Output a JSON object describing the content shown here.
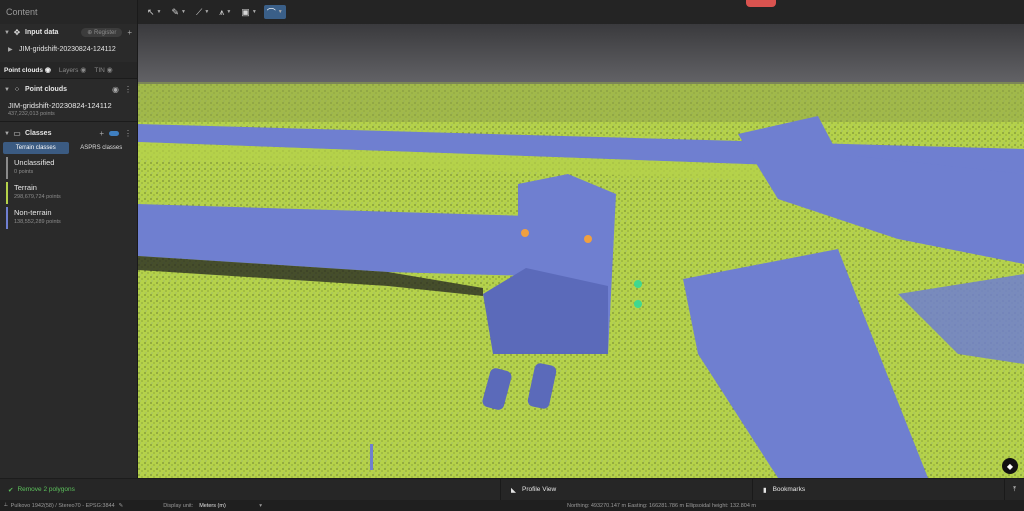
{
  "sidebar": {
    "title": "Content",
    "input_data": {
      "label": "Input data",
      "register_label": "Register",
      "dataset": "JIM-gridshift-20230824-124112"
    },
    "tabs": {
      "point_clouds": "Point clouds",
      "layers": "Layers",
      "tin": "TIN"
    },
    "point_clouds": {
      "label": "Point clouds",
      "name": "JIM-gridshift-20230824-124112",
      "count": "437,232,013 points"
    },
    "classes": {
      "label": "Classes",
      "tab_terrain": "Terrain classes",
      "tab_asprs": "ASPRS classes",
      "items": [
        {
          "name": "Unclassified",
          "count": "0 points",
          "color": "#8a8a8a"
        },
        {
          "name": "Terrain",
          "count": "298,679,724 points",
          "color": "#b5d24a"
        },
        {
          "name": "Non-terrain",
          "count": "138,552,289 points",
          "color": "#6f7fd0"
        }
      ]
    }
  },
  "toolbar": {
    "tools": [
      {
        "icon": "cursor-icon",
        "glyph": "↖"
      },
      {
        "icon": "pen-icon",
        "glyph": "✎"
      },
      {
        "icon": "measure-icon",
        "glyph": "⟋"
      },
      {
        "icon": "road-icon",
        "glyph": "⩚"
      },
      {
        "icon": "box-icon",
        "glyph": "▣"
      },
      {
        "icon": "view-mode-icon",
        "glyph": "⌒"
      }
    ]
  },
  "bottom": {
    "status": "Remove 2 polygons",
    "profile_view": "Profile View",
    "bookmarks": "Bookmarks"
  },
  "statusbar": {
    "crs": "Pulkovo 1942(58) / Stereo70 - EPSG:3844",
    "display_unit_label": "Display unit:",
    "display_unit_value": "Meters (m)",
    "coords": "Northing: 493270.147 m   Easting: 166281.786 m   Ellipsoidal height: 132.804 m"
  },
  "colors": {
    "terrain": "#b5d24a",
    "non_terrain": "#6f7fd0",
    "accent": "#3a5f88",
    "marker_orange": "#f0a040",
    "marker_green": "#40d890"
  }
}
